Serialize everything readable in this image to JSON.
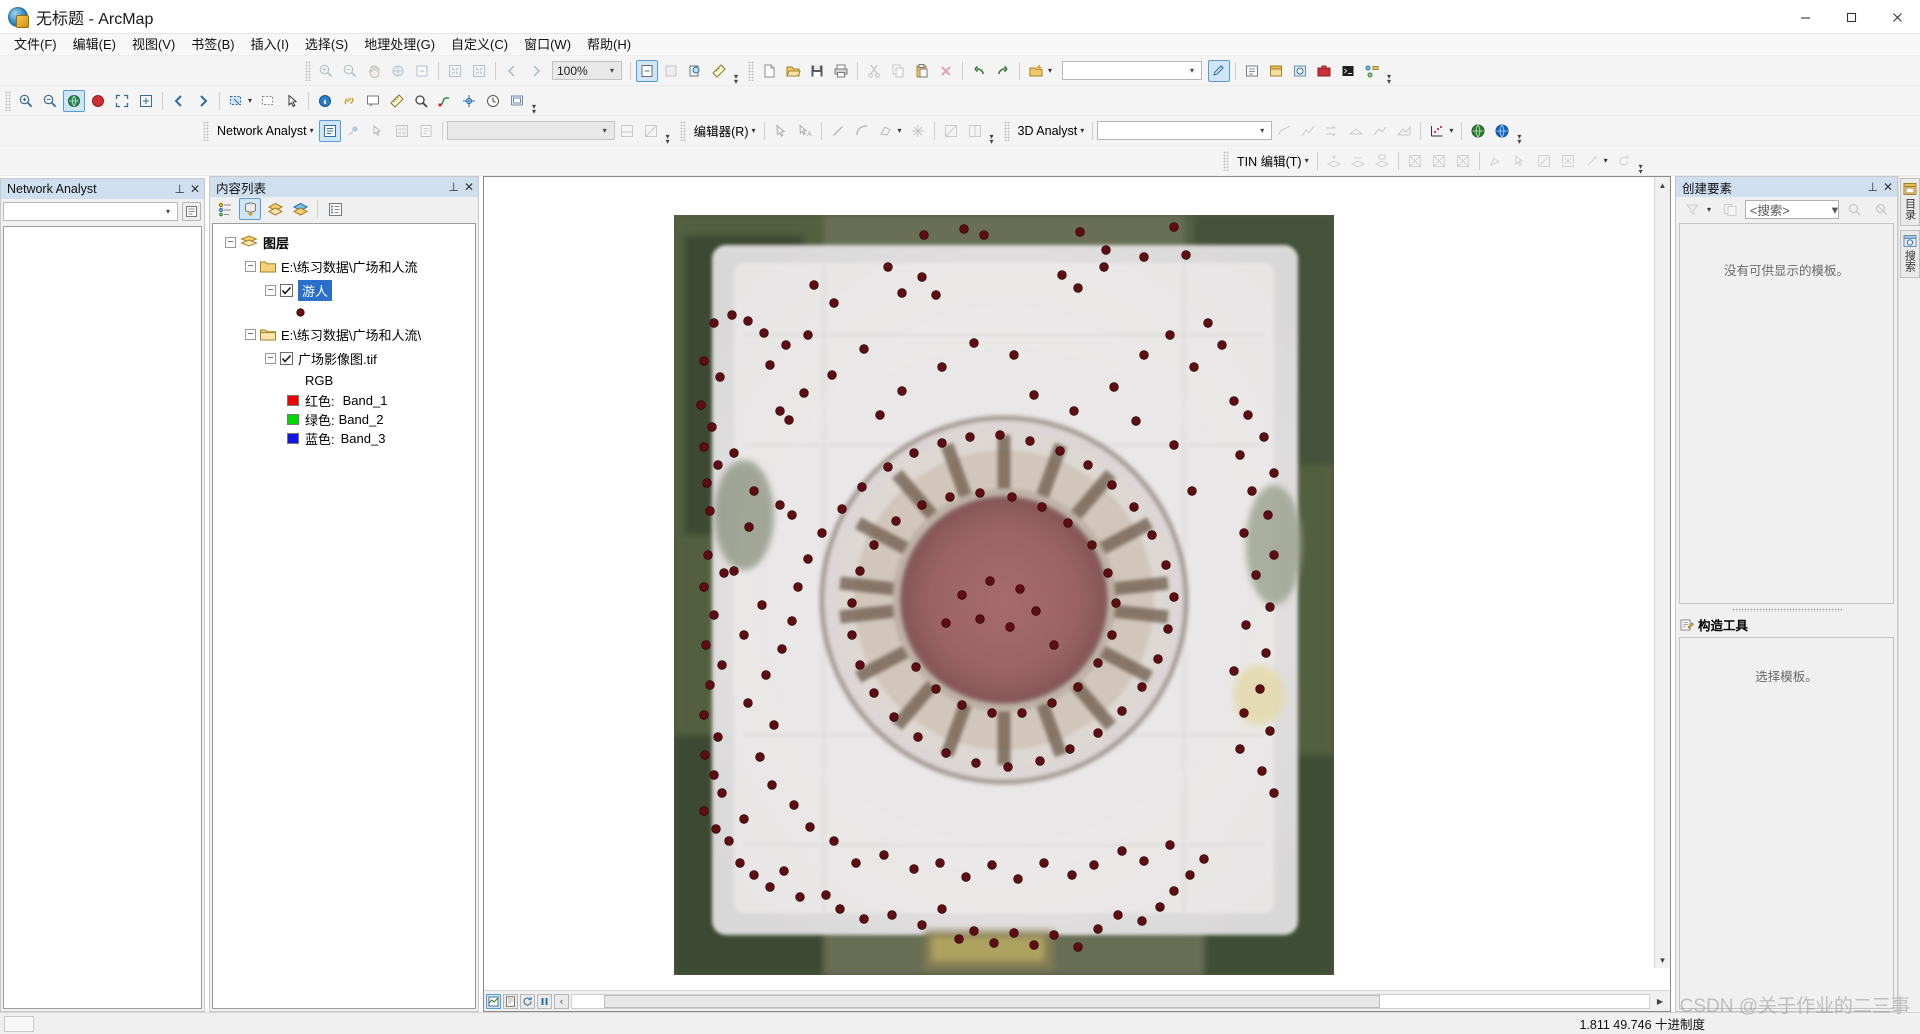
{
  "window": {
    "title": "无标题 - ArcMap",
    "app_icon": "arcmap-globe-icon",
    "minimize": "–",
    "maximize": "▢",
    "close": "✕"
  },
  "menubar": {
    "items": [
      {
        "label": "文件(F)",
        "name": "menu-file"
      },
      {
        "label": "编辑(E)",
        "name": "menu-edit"
      },
      {
        "label": "视图(V)",
        "name": "menu-view"
      },
      {
        "label": "书签(B)",
        "name": "menu-bookmarks"
      },
      {
        "label": "插入(I)",
        "name": "menu-insert"
      },
      {
        "label": "选择(S)",
        "name": "menu-selection"
      },
      {
        "label": "地理处理(G)",
        "name": "menu-geoprocessing"
      },
      {
        "label": "自定义(C)",
        "name": "menu-customize"
      },
      {
        "label": "窗口(W)",
        "name": "menu-window"
      },
      {
        "label": "帮助(H)",
        "name": "menu-help"
      }
    ]
  },
  "toolbars": {
    "tools_zoom_value": "100%",
    "network_analyst_label": "Network Analyst",
    "network_analyst_combo": "",
    "editor_label": "编辑器(R)",
    "editor_combo": "",
    "analyst3d_label": "3D Analyst",
    "analyst3d_combo": "",
    "tin_edit_label": "TIN 编辑(T)",
    "geocode_combo": ""
  },
  "network_analyst_panel": {
    "title": "Network Analyst",
    "combo_value": "",
    "pin": "⊥",
    "close": "✕"
  },
  "toc_panel": {
    "title": "内容列表",
    "pin": "⊥",
    "close": "✕",
    "buttons": [
      {
        "name": "list-by-drawing-order-button",
        "title": "按绘制顺序列出"
      },
      {
        "name": "list-by-source-button",
        "title": "按源列出"
      },
      {
        "name": "list-by-visibility-button",
        "title": "按可见性列出"
      },
      {
        "name": "list-by-selection-button",
        "title": "按选择列出"
      },
      {
        "name": "options-button",
        "title": "选项"
      }
    ],
    "tree": {
      "root": "图层",
      "groups": [
        {
          "path": "E:\\练习数据\\广场和人流",
          "layers": [
            {
              "name": "游人",
              "checked": true,
              "selected": true,
              "symbol": "point-dark-red"
            }
          ]
        },
        {
          "path": "E:\\练习数据\\广场和人流\\",
          "layers": [
            {
              "name": "广场影像图.tif",
              "checked": true,
              "selected": false,
              "renderer": "RGB",
              "bands": [
                {
                  "label": "红色:",
                  "value": "Band_1",
                  "color": "#ee0000"
                },
                {
                  "label": "绿色:",
                  "value": "Band_2",
                  "color": "#00d900"
                },
                {
                  "label": "蓝色:",
                  "value": "Band_3",
                  "color": "#1414e6"
                }
              ]
            }
          ]
        }
      ]
    }
  },
  "map": {
    "data_view_tab": "数据视图",
    "layout_view_tab": "布局视图",
    "refresh": "↻",
    "pause": "❚❚",
    "more": "‹"
  },
  "create_features_panel": {
    "title": "创建要素",
    "pin": "⊥",
    "close": "✕",
    "search_placeholder": "<搜索>",
    "templates_message": "没有可供显示的模板。",
    "construction_tools_title": "构造工具",
    "construction_tools_message": "选择模板。"
  },
  "dock_tabs": [
    {
      "label": "目录",
      "name": "dock-tab-catalog"
    },
    {
      "label": "搜索",
      "name": "dock-tab-search"
    }
  ],
  "statusbar": {
    "coordinates": "1.811  49.746 十进制度",
    "watermark": "CSDN @关于作业的二三事"
  },
  "colors": {
    "title_bar": "#ffffff",
    "panel_title": "#cfdff0",
    "selection_blue": "#2a6fc9",
    "toolbar_bg": "#f4f4f4",
    "point_red": "#6b0f14"
  }
}
